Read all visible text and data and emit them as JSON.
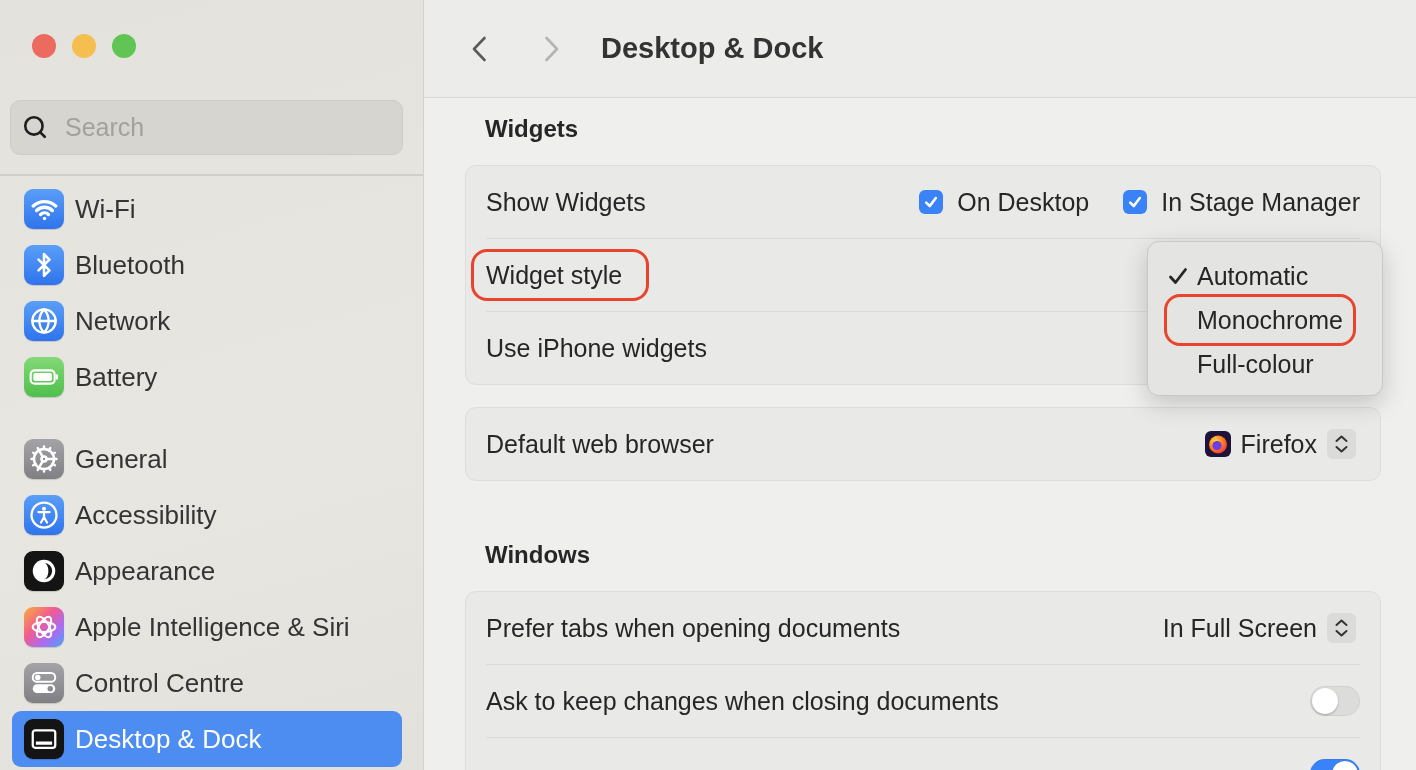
{
  "window_controls": [
    {
      "color": "#ec6a5e"
    },
    {
      "color": "#f4bf4f"
    },
    {
      "color": "#61c554"
    }
  ],
  "sidebar": {
    "search": {
      "placeholder": "Search"
    },
    "groups": [
      {
        "items": [
          {
            "kind": "wifi",
            "label": "Wi-Fi",
            "selected": false
          },
          {
            "kind": "bluetooth",
            "label": "Bluetooth",
            "selected": false
          },
          {
            "kind": "network",
            "label": "Network",
            "selected": false
          },
          {
            "kind": "battery",
            "label": "Battery",
            "selected": false
          }
        ]
      },
      {
        "items": [
          {
            "kind": "general",
            "label": "General",
            "selected": false
          },
          {
            "kind": "accessibility",
            "label": "Accessibility",
            "selected": false
          },
          {
            "kind": "appearance",
            "label": "Appearance",
            "selected": false
          },
          {
            "kind": "intelligence",
            "label": "Apple Intelligence & Siri",
            "selected": false
          },
          {
            "kind": "control",
            "label": "Control Centre",
            "selected": false
          },
          {
            "kind": "desktop",
            "label": "Desktop & Dock",
            "selected": true
          }
        ]
      }
    ]
  },
  "header": {
    "back": {
      "disabled": false
    },
    "forward": {
      "disabled": true
    },
    "title": "Desktop & Dock"
  },
  "sections": [
    {
      "title": "Widgets",
      "cards": [
        {
          "rows": [
            {
              "kind": "checkboxes",
              "label": "Show Widgets",
              "circled": false,
              "options": [
                {
                  "label": "On Desktop",
                  "checked": true
                },
                {
                  "label": "In Stage Manager",
                  "checked": true
                }
              ]
            },
            {
              "kind": "plain",
              "label": "Widget style",
              "circled": true,
              "menu": {
                "items": [
                  {
                    "label": "Automatic",
                    "selected": true,
                    "circled": false
                  },
                  {
                    "label": "Monochrome",
                    "selected": false,
                    "circled": true
                  },
                  {
                    "label": "Full-colour",
                    "selected": false,
                    "circled": false
                  }
                ]
              }
            },
            {
              "kind": "plain",
              "label": "Use iPhone widgets",
              "circled": false
            }
          ]
        },
        {
          "rows": [
            {
              "kind": "select",
              "label": "Default web browser",
              "circled": false,
              "value": "Firefox",
              "app_icon": true
            }
          ]
        }
      ]
    },
    {
      "title": "Windows",
      "cards": [
        {
          "rows": [
            {
              "kind": "select",
              "label": "Prefer tabs when opening documents",
              "circled": false,
              "value": "In Full Screen"
            },
            {
              "kind": "toggle",
              "label": "Ask to keep changes when closing documents",
              "circled": false,
              "on": false
            },
            {
              "kind": "toggle",
              "on": true
            }
          ]
        }
      ]
    }
  ]
}
